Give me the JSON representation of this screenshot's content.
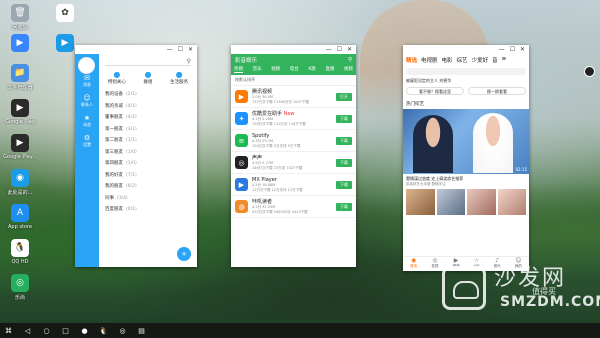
{
  "desktop": {
    "icons": [
      {
        "label": "回收站",
        "color": "#9aa7b0",
        "glyph": "🗑"
      },
      {
        "label": "",
        "color": "#ffffff",
        "glyph": "✿"
      },
      {
        "label": "",
        "color": "#3a86ff",
        "glyph": "▶"
      },
      {
        "label": "",
        "color": "#1c9be6",
        "glyph": "▶"
      },
      {
        "label": "文件管理器",
        "color": "#4a90e2",
        "glyph": "📁"
      },
      {
        "label": "Google Play",
        "color": "#2b2b2b",
        "glyph": "▶"
      },
      {
        "label": "Google Play...",
        "color": "#2b2b2b",
        "glyph": "▶"
      },
      {
        "label": "",
        "color": "#e94b3c",
        "glyph": "✦"
      },
      {
        "label": "此处是的...",
        "color": "#1c9be6",
        "glyph": "◉"
      },
      {
        "label": "App store",
        "color": "#1f8ef1",
        "glyph": "A"
      },
      {
        "label": "QQ HD",
        "color": "#ffffff",
        "glyph": "🐧"
      },
      {
        "label": "乐尚",
        "color": "#27ae60",
        "glyph": "◎"
      }
    ]
  },
  "qq_window": {
    "controls": [
      "—",
      "☐",
      "✕"
    ],
    "search_icon": "⚲",
    "nav": [
      {
        "icon": "✉",
        "label": "消息"
      },
      {
        "icon": "☺",
        "label": "联系人"
      },
      {
        "icon": "★",
        "label": "动态"
      },
      {
        "icon": "⚙",
        "label": "设置"
      }
    ],
    "top_actions": [
      {
        "icon": "●",
        "label": "特别关心"
      },
      {
        "icon": "●",
        "label": "群组"
      },
      {
        "icon": "●",
        "label": "生活服务"
      }
    ],
    "groups": [
      {
        "name": "我的设备",
        "count": "(2/1)"
      },
      {
        "name": "我的亲戚",
        "count": "(4/1)"
      },
      {
        "name": "董事朋友",
        "count": "(4/2)"
      },
      {
        "name": "第一朋友",
        "count": "(3/1)"
      },
      {
        "name": "第二朋友",
        "count": "(1/1)"
      },
      {
        "name": "第三朋友",
        "count": "(1/0)"
      },
      {
        "name": "第四朋友",
        "count": "(1/0)"
      },
      {
        "name": "我的好友",
        "count": "(7/1)"
      },
      {
        "name": "我的朋友",
        "count": "(6/2)"
      },
      {
        "name": "同事",
        "count": "(3/4)"
      },
      {
        "name": "百度朋友",
        "count": "(0/1)"
      }
    ],
    "fab": "+"
  },
  "store_window": {
    "controls": [
      "—",
      "☐",
      "✕"
    ],
    "title": "影音娱乐",
    "search_icon": "⚲",
    "tabs": [
      "热销",
      "音乐",
      "视频",
      "电台",
      "K歌",
      "直播",
      "视频"
    ],
    "sort_label": "按默认排序",
    "apps": [
      {
        "name": "腾讯视频",
        "meta1": "3.0分 38.0M",
        "meta2": "737万次下载 11380万次 1007下载",
        "button": "打开",
        "color": "#ff7a00",
        "glyph": "▶",
        "new": ""
      },
      {
        "name": "优酷爱在助手",
        "meta1": "4.1分 2.28M",
        "meta2": "126万次下载 110万次 116万下载",
        "button": "下载",
        "color": "#1e90ff",
        "glyph": "✦",
        "new": "New"
      },
      {
        "name": "Spotify",
        "meta1": "4.3分 29.7M",
        "meta2": "104万次下载 5万次评 9万下载",
        "button": "下载",
        "color": "#1db954",
        "glyph": "≡",
        "new": ""
      },
      {
        "name": "声声",
        "meta1": "4.5分 5.27M",
        "meta2": "146万次下载 23万次 7427下载",
        "button": "下载",
        "color": "#222222",
        "glyph": "◎",
        "new": ""
      },
      {
        "name": "MX Player",
        "meta1": "4.5分 18.08M",
        "meta2": "12万次下载 12万次评 12万下载",
        "button": "下载",
        "color": "#2a7ae2",
        "glyph": "▶",
        "new": ""
      },
      {
        "name": "咔叽读者",
        "meta1": "4.2分 32.03M",
        "meta2": "515万次下载 548535分 4425下载",
        "button": "下载",
        "color": "#f08c2a",
        "glyph": "◍",
        "new": ""
      }
    ]
  },
  "video_window": {
    "controls": [
      "—",
      "☐",
      "✕"
    ],
    "back": "‹",
    "tabs": [
      "精选",
      "电视剧",
      "电影",
      "综艺",
      "少爱好",
      "音",
      "≡"
    ],
    "search_placeholder": "",
    "headline": "被疑犯设定的主人 刘德华",
    "btns": [
      "看不够？搜看这里",
      "换一换看看"
    ],
    "hot_title": "热门综艺",
    "duration": "02:15",
    "video_title": "窦情谋过态度 史上搞笑综艺推荐",
    "video_sub": "某某综艺大本营 剧情关注",
    "nav": [
      {
        "icon": "◉",
        "label": "首页"
      },
      {
        "icon": "◎",
        "label": "发现"
      },
      {
        "icon": "▶",
        "label": "频道"
      },
      {
        "icon": "☆",
        "label": "VIP"
      },
      {
        "icon": "♪",
        "label": "音乐"
      },
      {
        "icon": "☺",
        "label": "我的"
      }
    ]
  },
  "taskbar": {
    "items": [
      "⌘",
      "◁",
      "○",
      "□",
      "●",
      "🐧",
      "◎",
      "▤"
    ]
  },
  "watermark": {
    "zh": "沙发网",
    "en": "SMZDM.COM",
    "small": "值得买"
  }
}
